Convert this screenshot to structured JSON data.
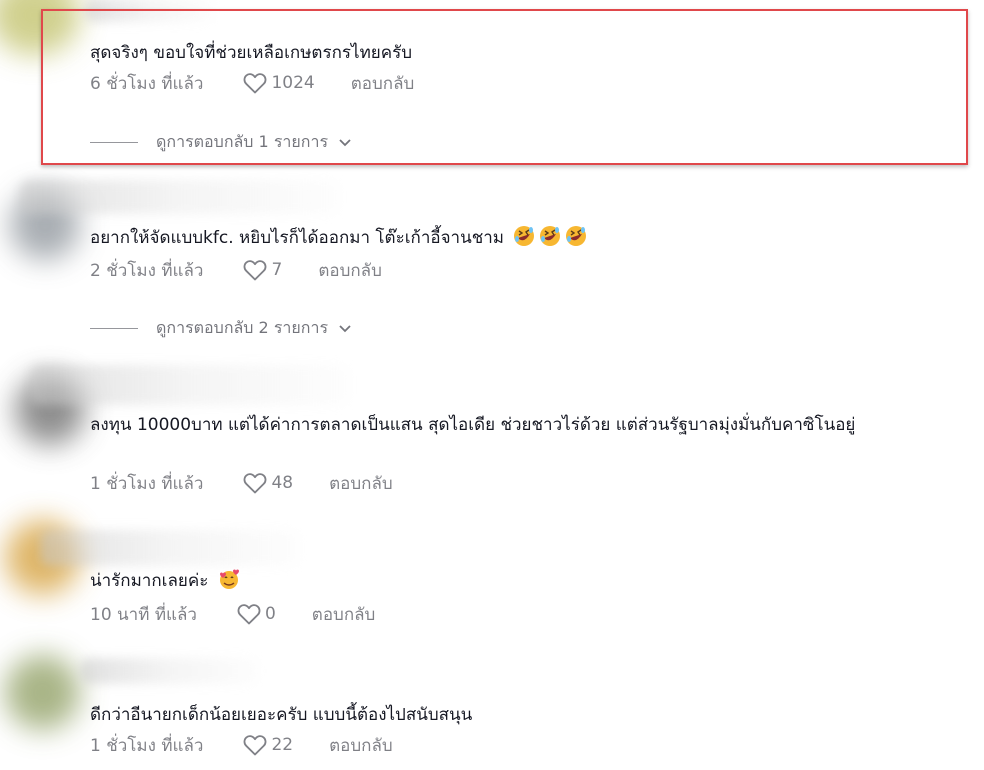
{
  "comments": [
    {
      "partial_name": "",
      "text": "สุดจริงๆ ขอบใจที่ช่วยเหลือเกษตรกรไทยครับ",
      "time": "6 ชั่วโมง ที่แล้ว",
      "likes": "1024",
      "reply": "ตอบกลับ",
      "view_replies": "ดูการตอบกลับ 1 รายการ",
      "highlighted": true
    },
    {
      "partial_name": "",
      "text": "อยากให้จัดแบบkfc. หยิบไรก็ได้ออกมา โต๊ะเก้าอี้จานชาม",
      "emoji": "rolling-laughing-emoji",
      "time": "2 ชั่วโมง ที่แล้ว",
      "likes": "7",
      "reply": "ตอบกลับ",
      "view_replies": "ดูการตอบกลับ 2 รายการ"
    },
    {
      "partial_name": "",
      "text": "ลงทุน 10000บาท แต่ได้ค่าการตลาดเป็นแสน สุดไอเดีย ช่วยชาวไร่ด้วย แต่ส่วนรัฐบาลมุ่งมั่นกับคาซิโนอยู่",
      "time": "1 ชั่วโมง ที่แล้ว",
      "likes": "48",
      "reply": "ตอบกลับ"
    },
    {
      "partial_name": "",
      "text": "น่ารักมากเลยค่ะ",
      "emoji": "smiling-hearts-emoji",
      "time": "10 นาที ที่แล้ว",
      "likes": "0",
      "reply": "ตอบกลับ"
    },
    {
      "partial_name": "",
      "text": "ดีกว่าอีนายกเด็กน้อยเยอะครับ แบบนี้ต้องไปสนับสนุน",
      "time": "1 ชั่วโมง ที่แล้ว",
      "likes": "22",
      "reply": "ตอบกลับ"
    }
  ],
  "icons": {
    "like": "heart-outline-icon",
    "expand": "chevron-down-icon"
  },
  "colors": {
    "highlight_border": "#e0484b",
    "text": "#161823",
    "secondary": "#8a8b91"
  }
}
